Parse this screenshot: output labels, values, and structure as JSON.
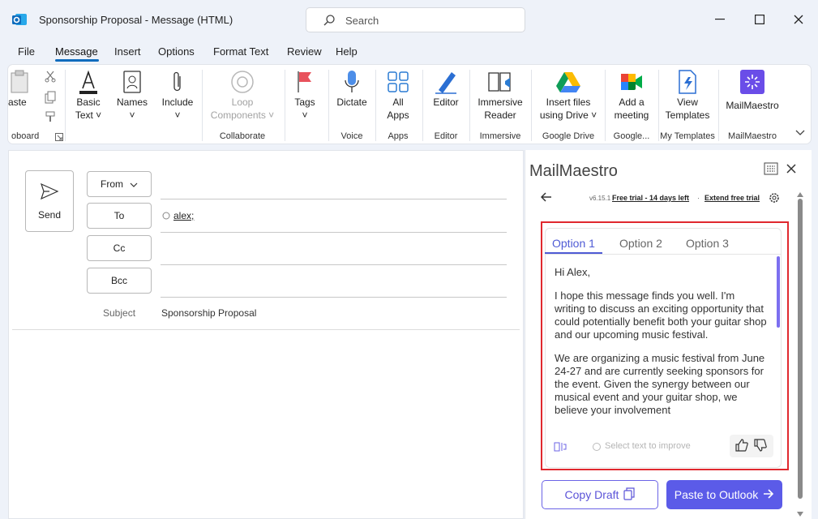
{
  "window": {
    "title": "Sponsorship Proposal  -  Message (HTML)",
    "search_placeholder": "Search"
  },
  "menu": [
    "File",
    "Message",
    "Insert",
    "Options",
    "Format Text",
    "Review",
    "Help"
  ],
  "ribbon": {
    "paste": "aste",
    "clipboard_group": "oboard",
    "basic_text_1": "Basic",
    "basic_text_2": "Text",
    "names": "Names",
    "include": "Include",
    "loop_1": "Loop",
    "loop_2": "Components",
    "collaborate_group": "Collaborate",
    "tags": "Tags",
    "dictate": "Dictate",
    "voice_group": "Voice",
    "all_apps_1": "All",
    "all_apps_2": "Apps",
    "apps_group": "Apps",
    "editor": "Editor",
    "editor_group": "Editor",
    "immersive_1": "Immersive",
    "immersive_2": "Reader",
    "immersive_group": "Immersive",
    "insert_files_1": "Insert files",
    "insert_files_2": "using Drive",
    "google_drive_group": "Google Drive",
    "meeting_1": "Add a",
    "meeting_2": "meeting",
    "google_group": "Google...",
    "templates_1": "View",
    "templates_2": "Templates",
    "my_templates_group": "My Templates",
    "mailmaestro": "MailMaestro",
    "mailmaestro_group": "MailMaestro"
  },
  "compose": {
    "send": "Send",
    "from": "From",
    "to": "To",
    "cc": "Cc",
    "bcc": "Bcc",
    "to_value": "alex;",
    "subject_label": "Subject",
    "subject_value": "Sponsorship Proposal"
  },
  "panel": {
    "title": "MailMaestro",
    "version": "v6.15.1",
    "trial": "Free trial - 14 days left",
    "separator": "·",
    "extend": "Extend free trial",
    "tabs": [
      "Option 1",
      "Option 2",
      "Option 3"
    ],
    "draft": [
      "Hi Alex,",
      "I hope this message finds you well. I'm writing to discuss an exciting opportunity that could potentially benefit both your guitar shop and our upcoming music festival.",
      "We are organizing a music festival from June 24-27 and are currently seeking sponsors for the event. Given the synergy between our musical event and your guitar shop, we believe your involvement"
    ],
    "improve_placeholder": "Select text to improve",
    "copy_draft": "Copy Draft",
    "paste_to_outlook": "Paste to Outlook"
  },
  "colors": {
    "accent": "#0f6cbd",
    "maestro": "#5b5be8",
    "highlight_box": "#e0282e"
  }
}
